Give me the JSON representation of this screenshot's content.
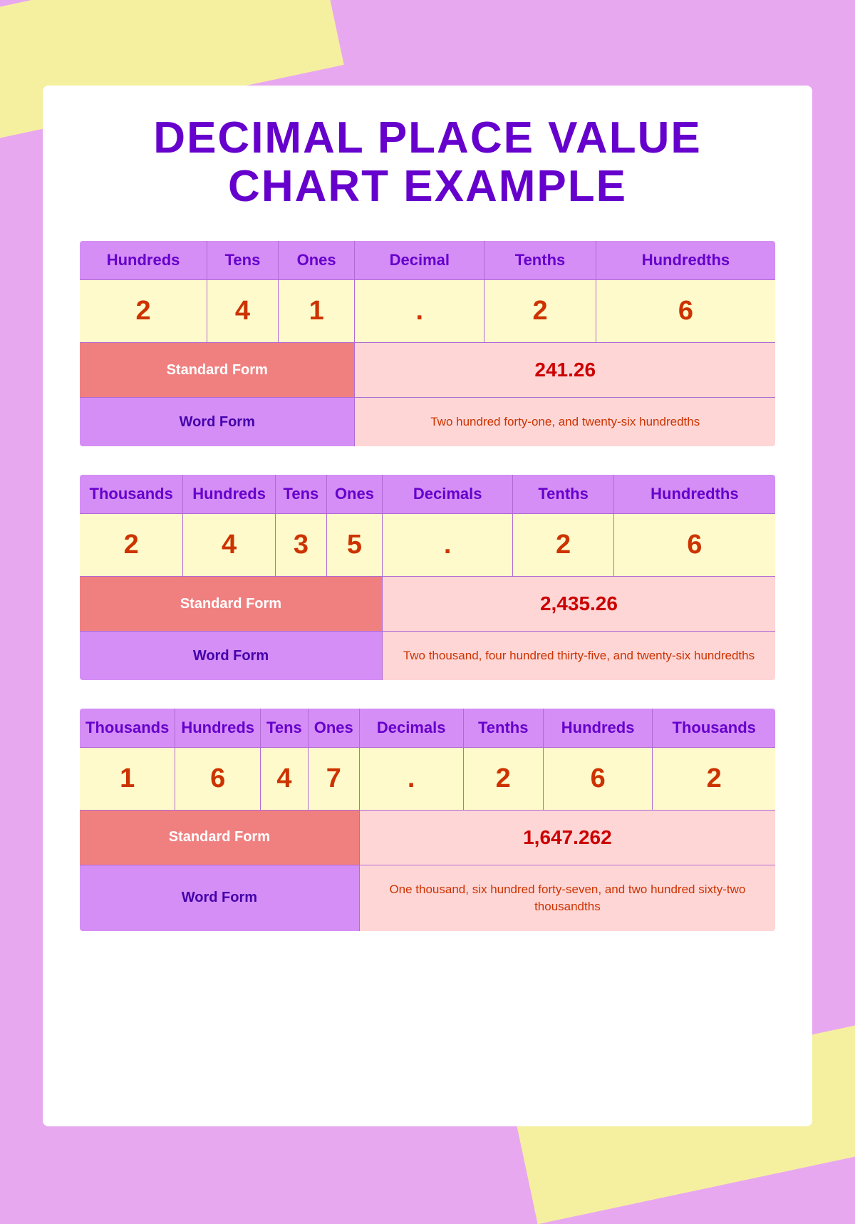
{
  "page": {
    "title_line1": "DECIMAL PLACE VALUE",
    "title_line2": "CHART EXAMPLE",
    "bg_color": "#e8a8f0",
    "accent_yellow": "#f5f0a0",
    "white_bg": "#ffffff"
  },
  "tables": [
    {
      "id": "table1",
      "headers": [
        "Hundreds",
        "Tens",
        "Ones",
        "Decimal",
        "Tenths",
        "Hundredths"
      ],
      "data_row": [
        "2",
        "4",
        "1",
        ".",
        "2",
        "6"
      ],
      "standard_form_label": "Standard Form",
      "standard_form_value": "241.26",
      "word_form_label": "Word Form",
      "word_form_value": "Two hundred forty-one, and twenty-six hundredths"
    },
    {
      "id": "table2",
      "headers": [
        "Thousands",
        "Hundreds",
        "Tens",
        "Ones",
        "Decimals",
        "Tenths",
        "Hundredths"
      ],
      "data_row": [
        "2",
        "4",
        "3",
        "5",
        ".",
        "2",
        "6"
      ],
      "standard_form_label": "Standard Form",
      "standard_form_value": "2,435.26",
      "word_form_label": "Word Form",
      "word_form_value": "Two thousand, four hundred thirty-five, and twenty-six hundredths"
    },
    {
      "id": "table3",
      "headers": [
        "Thousands",
        "Hundreds",
        "Tens",
        "Ones",
        "Decimals",
        "Tenths",
        "Hundreds",
        "Thousands"
      ],
      "data_row": [
        "1",
        "6",
        "4",
        "7",
        ".",
        "2",
        "6",
        "2"
      ],
      "standard_form_label": "Standard Form",
      "standard_form_value": "1,647.262",
      "word_form_label": "Word Form",
      "word_form_value": "One thousand, six hundred forty-seven, and two hundred sixty-two thousandths"
    }
  ]
}
